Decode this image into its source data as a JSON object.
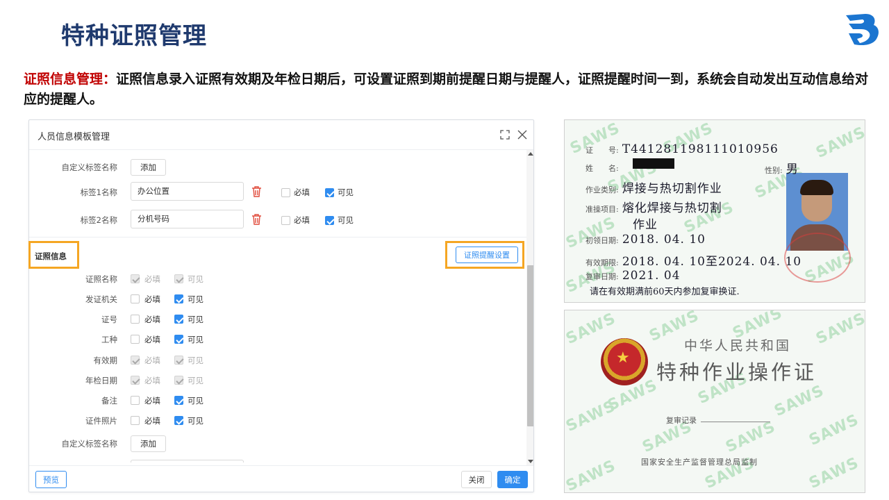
{
  "slide": {
    "title": "特种证照管理",
    "desc_label": "证照信息管理：",
    "desc_text": "证照信息录入证照有效期及年检日期后，可设置证照到期前提醒日期与提醒人，证照提醒时间一到，系统会自动发出互动信息给对应的提醒人。"
  },
  "dialog": {
    "title": "人员信息模板管理",
    "custom_tag_label": "自定义标签名称",
    "add_label": "添加",
    "tag_rows": [
      {
        "label": "标签1名称",
        "value": "办公位置",
        "required": false,
        "visible": true
      },
      {
        "label": "标签2名称",
        "value": "分机号码",
        "required": false,
        "visible": true
      }
    ],
    "required_text": "必填",
    "visible_text": "可见",
    "section_title": "证照信息",
    "remind_button": "证照提醒设置",
    "fields": [
      {
        "label": "证照名称",
        "required": "disabled-checked",
        "visible": "disabled-checked"
      },
      {
        "label": "发证机关",
        "required": "off",
        "visible": "on"
      },
      {
        "label": "证号",
        "required": "off",
        "visible": "on"
      },
      {
        "label": "工种",
        "required": "off",
        "visible": "on"
      },
      {
        "label": "有效期",
        "required": "disabled-checked",
        "visible": "disabled-checked"
      },
      {
        "label": "年检日期",
        "required": "disabled-checked",
        "visible": "disabled-checked"
      },
      {
        "label": "备注",
        "required": "off",
        "visible": "on"
      },
      {
        "label": "证件照片",
        "required": "off",
        "visible": "on"
      }
    ],
    "preview": "预览",
    "close": "关闭",
    "ok": "确定"
  },
  "cert_front": {
    "watermark": "SAWS",
    "no_key": "证　　号:",
    "no_val": "T441281198111010956",
    "name_key": "姓　　名:",
    "sex_key": "性别:",
    "sex_val": "男",
    "type_key": "作业类别:",
    "type_val": "焊接与热切割作业",
    "item_key": "准操项目:",
    "item_val1": "熔化焊接与热切割",
    "item_val2": "作业",
    "first_key": "初领日期:",
    "first_val": "2018. 04. 10",
    "valid_key": "有效期限:",
    "valid_val": "2018. 04. 10至2024. 04. 10",
    "review_key": "复审日期:",
    "review_val": "2021. 04",
    "note": "请在有效期满前60天内参加复审换证."
  },
  "cert_back": {
    "watermark": "SAWS",
    "country": "中华人民共和国",
    "title": "特种作业操作证",
    "record": "复审记录",
    "issuer": "国家安全生产监督管理总局监制"
  },
  "colors": {
    "accent": "#2f8cf0",
    "highlight": "#f5a623",
    "title": "#1f3a6e",
    "red": "#c00000"
  }
}
